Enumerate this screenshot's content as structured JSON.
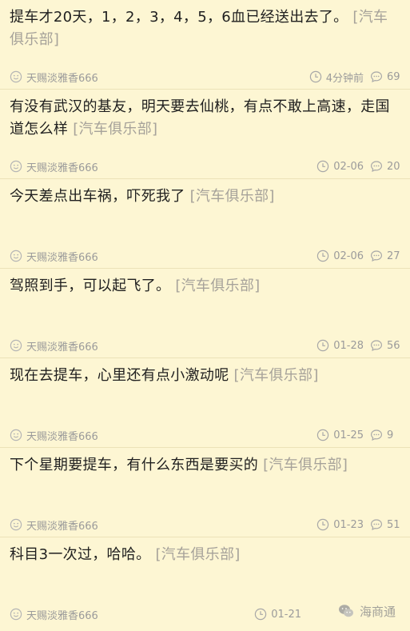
{
  "feed": {
    "posts": [
      {
        "text": "提车才20天，1，2，3，4，5，6血已经送出去了。",
        "tag": "[汽车俱乐部]",
        "author": "天赐淡雅香666",
        "time": "4分钟前",
        "comments": "69"
      },
      {
        "text": "有没有武汉的基友，明天要去仙桃，有点不敢上高速，走国道怎么样",
        "tag": "[汽车俱乐部]",
        "author": "天赐淡雅香666",
        "time": "02-06",
        "comments": "20"
      },
      {
        "text": "今天差点出车祸，吓死我了",
        "tag": "[汽车俱乐部]",
        "author": "天赐淡雅香666",
        "time": "02-06",
        "comments": "27"
      },
      {
        "text": "驾照到手，可以起飞了。",
        "tag": "[汽车俱乐部]",
        "author": "天赐淡雅香666",
        "time": "01-28",
        "comments": "56"
      },
      {
        "text": "现在去提车，心里还有点小激动呢",
        "tag": "[汽车俱乐部]",
        "author": "天赐淡雅香666",
        "time": "01-25",
        "comments": "9"
      },
      {
        "text": "下个星期要提车，有什么东西是要买的",
        "tag": "[汽车俱乐部]",
        "author": "天赐淡雅香666",
        "time": "01-23",
        "comments": "51"
      },
      {
        "text": "科目3一次过，哈哈。",
        "tag": "[汽车俱乐部]",
        "author": "天赐淡雅香666",
        "time": "01-21",
        "comments": ""
      }
    ]
  },
  "watermark": {
    "left_text": "",
    "right_text": "海商通",
    "right_icon": "wechat-icon"
  },
  "icons": {
    "author": "smiley-icon",
    "time": "clock-icon",
    "comments": "comment-bubble-icon"
  },
  "colors": {
    "background": "#fdf6d3",
    "text": "#1f1f1f",
    "tag": "#a6a29a",
    "meta": "#9b9b9b",
    "divider": "#ece2b8"
  }
}
